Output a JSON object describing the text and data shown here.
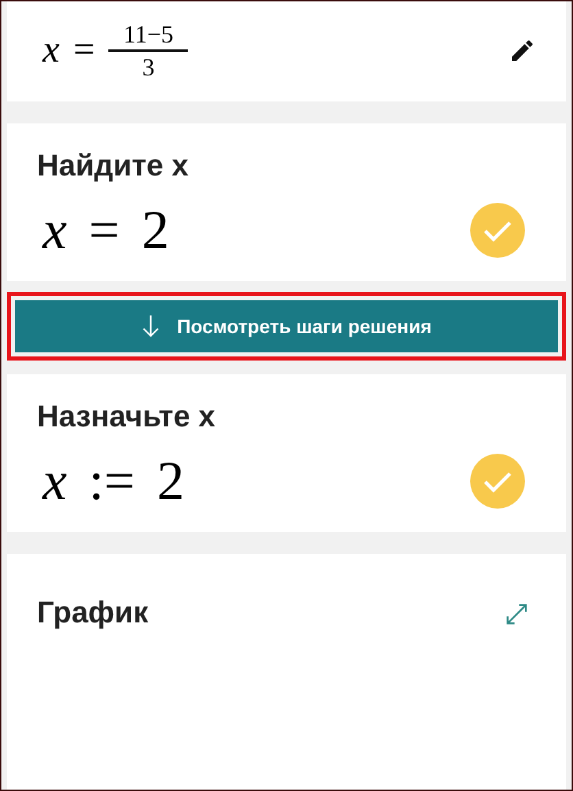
{
  "equation": {
    "lhs": "x",
    "op": "=",
    "numerator": "11−5",
    "denominator": "3"
  },
  "results": [
    {
      "title": "Найдите x",
      "lhs": "x",
      "op": "=",
      "rhs": "2",
      "verified": true
    },
    {
      "title": "Назначьте x",
      "lhs": "x",
      "op": ":=",
      "rhs": "2",
      "verified": true
    }
  ],
  "steps_button": {
    "label": "Посмотреть шаги решения",
    "highlighted": true
  },
  "graph": {
    "title": "График"
  }
}
